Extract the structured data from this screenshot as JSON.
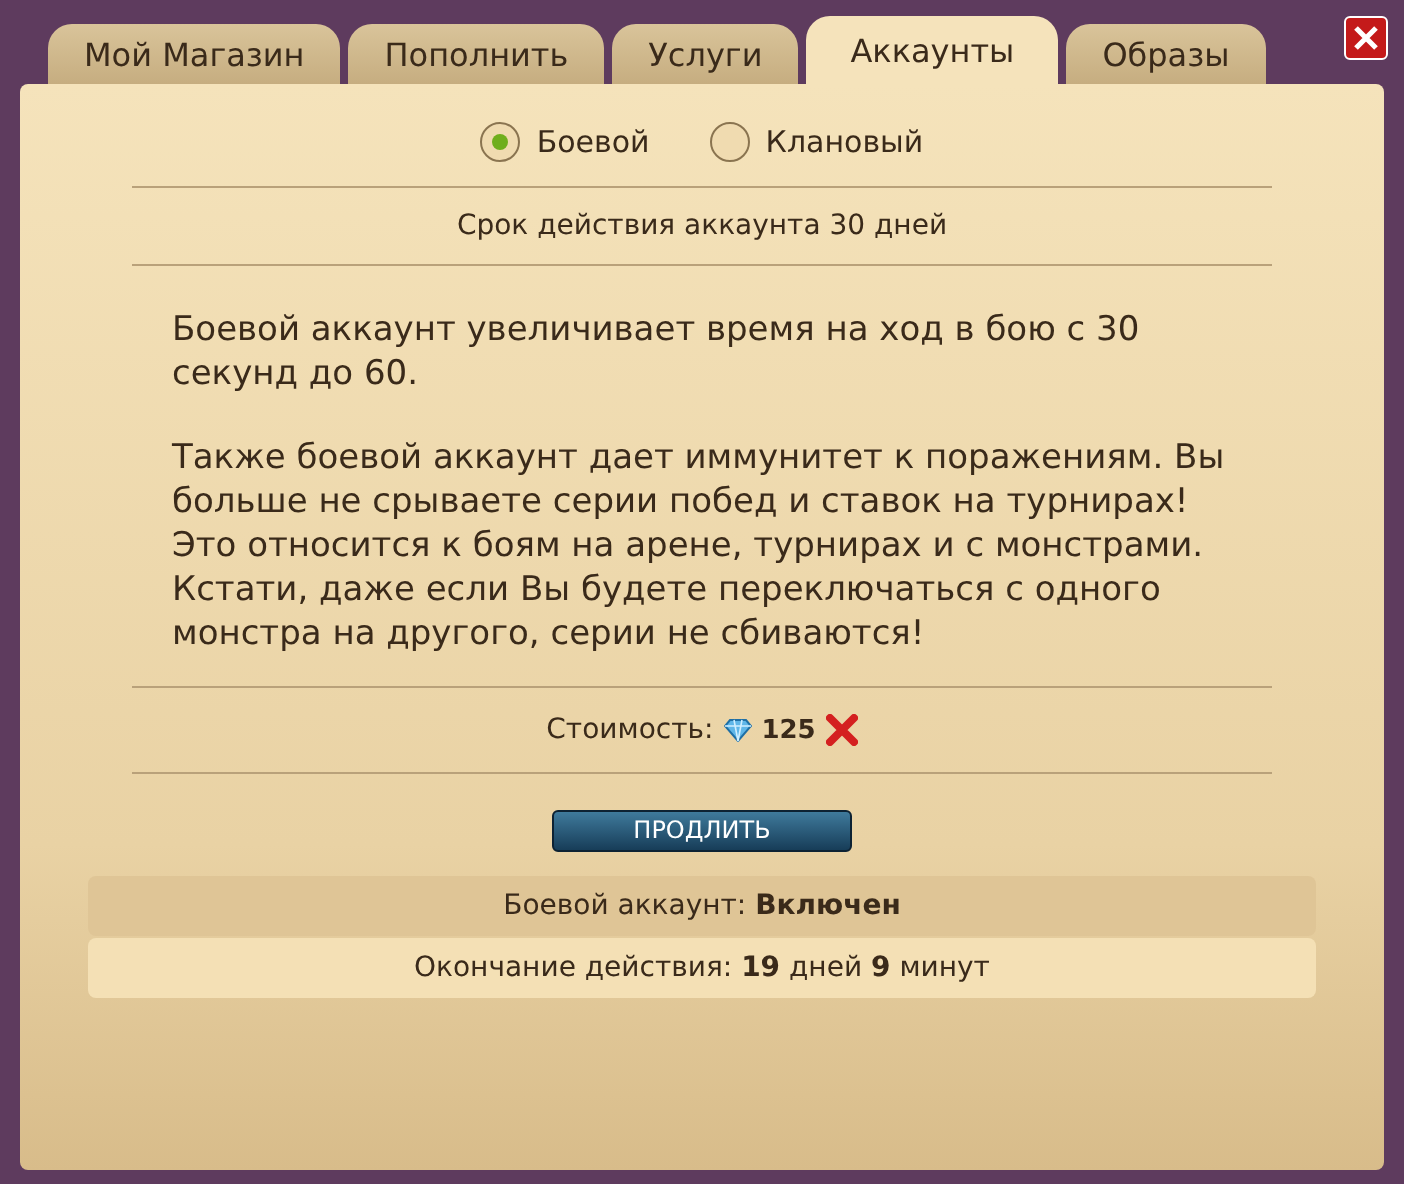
{
  "tabs": [
    {
      "label": "Мой Магазин",
      "selected": false
    },
    {
      "label": "Пополнить",
      "selected": false
    },
    {
      "label": "Услуги",
      "selected": false
    },
    {
      "label": "Аккаунты",
      "selected": true
    },
    {
      "label": "Образы",
      "selected": false
    }
  ],
  "account_types": [
    {
      "label": "Боевой",
      "selected": true
    },
    {
      "label": "Клановый",
      "selected": false
    }
  ],
  "duration": "Срок действия аккаунта 30 дней",
  "description": [
    "Боевой аккаунт увеличивает время на ход в бою с 30 секунд до 60.",
    "Также боевой аккаунт дает иммунитет к поражениям. Вы больше не срываете серии побед и ставок на турнирах! Это относится к боям на арене, турнирах и с монстрами. Кстати, даже если Вы будете переключаться с одного монстра на другого, серии не сбиваются!"
  ],
  "cost": {
    "label": "Стоимость:",
    "amount": "125"
  },
  "extend_button": "ПРОДЛИТЬ",
  "status_rows": [
    "Боевой аккаунт: **Включен**",
    "Окончание действия: **19** дней **9** минут"
  ]
}
